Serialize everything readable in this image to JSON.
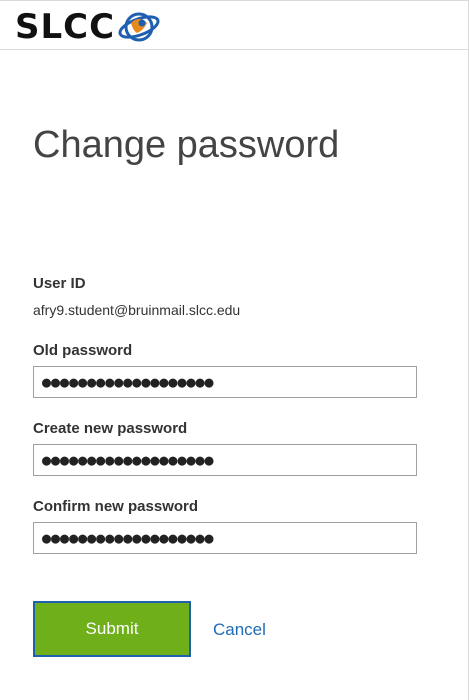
{
  "header": {
    "logo_text": "SLCC"
  },
  "page": {
    "title": "Change password"
  },
  "form": {
    "user_id_label": "User ID",
    "user_id_value": "afry9.student@bruinmail.slcc.edu",
    "old_password_label": "Old password",
    "old_password_value": "●●●●●●●●●●●●●●●●●●●",
    "new_password_label": "Create new password",
    "new_password_value": "●●●●●●●●●●●●●●●●●●●",
    "confirm_password_label": "Confirm new password",
    "confirm_password_value": "●●●●●●●●●●●●●●●●●●●",
    "submit_label": "Submit",
    "cancel_label": "Cancel"
  },
  "colors": {
    "submit_bg": "#6fb01a",
    "submit_border": "#1f5fb0",
    "link": "#1f6bb5",
    "logo_orange": "#e8891c",
    "logo_blue": "#1f5fb0"
  },
  "icons": {
    "logo_mark": "slcc-globe-logo-icon"
  }
}
